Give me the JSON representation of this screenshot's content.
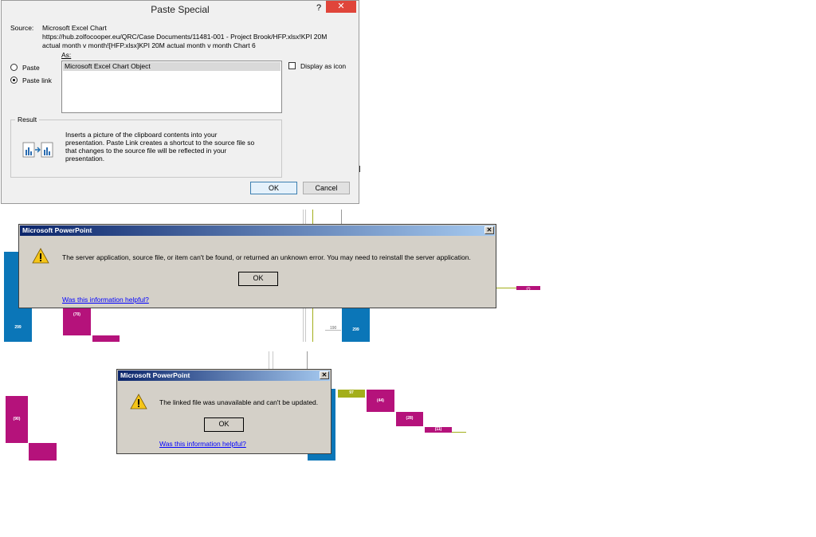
{
  "paste_special": {
    "title": "Paste Special",
    "help": "?",
    "close": "✕",
    "source_label": "Source:",
    "source_lines": [
      "Microsoft Excel Chart",
      "https://hub.zolfocooper.eu/QRC/Case Documents/11481-001 - Project Brook/HFP.xlsx!KPI 20M",
      "actual month v month![HFP.xlsx]KPI 20M actual month v month Chart 6"
    ],
    "as_label": "As:",
    "options": {
      "paste": "Paste",
      "paste_link": "Paste link",
      "selected": "paste_link"
    },
    "as_list": [
      "Microsoft Excel Chart Object"
    ],
    "display_as_icon": "Display as icon",
    "result_label": "Result",
    "result_text": [
      "Inserts a picture of the clipboard contents into your",
      "presentation. Paste Link creates a shortcut to the source file so",
      "that changes to the source file will be reflected in your",
      "presentation."
    ],
    "ok": "OK",
    "cancel": "Cancel"
  },
  "error1": {
    "title": "Microsoft PowerPoint",
    "close": "✕",
    "message": "The server application, source file, or item can't be found, or returned an unknown error. You may need to reinstall the server application.",
    "ok": "OK",
    "link": "Was this information helpful?"
  },
  "error2": {
    "title": "Microsoft PowerPoint",
    "close": "✕",
    "message": "The linked file was unavailable and can't be updated.",
    "ok": "OK",
    "link": "Was this information helpful?"
  },
  "background_chart": {
    "labels": [
      "299",
      "(70)",
      "(7)",
      "190",
      "299",
      "(90)",
      "97",
      "(44)",
      "(28)",
      "(11)"
    ],
    "colors": {
      "blue": "#0b76b8",
      "magenta": "#b5127b",
      "olive": "#a3ae1a"
    }
  }
}
